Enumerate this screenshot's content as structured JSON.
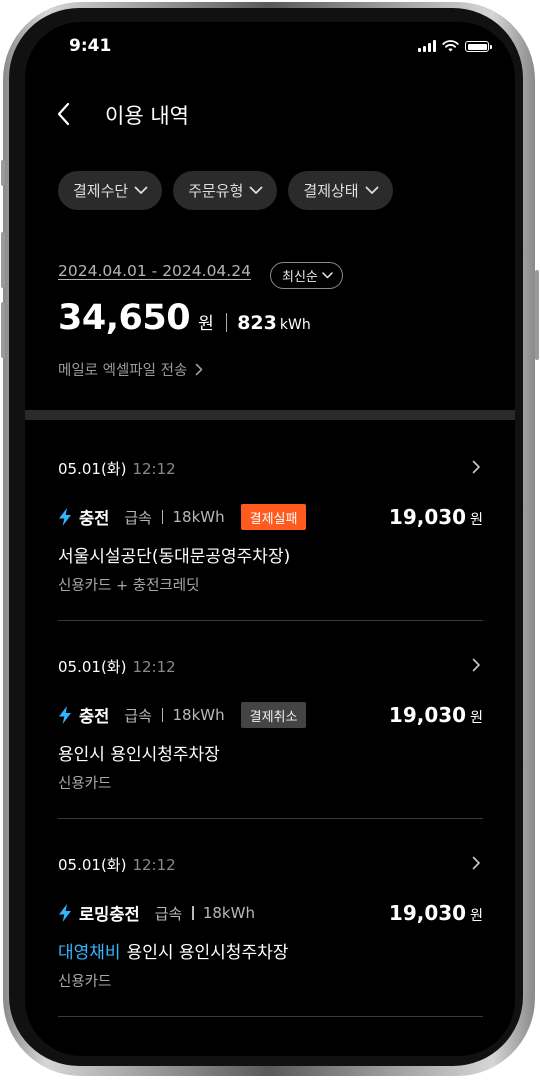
{
  "status_bar": {
    "time": "9:41"
  },
  "header": {
    "title": "이용 내역"
  },
  "filters": [
    {
      "label": "결제수단"
    },
    {
      "label": "주문유형"
    },
    {
      "label": "결제상태"
    }
  ],
  "summary": {
    "date_range": "2024.04.01 - 2024.04.24",
    "sort_label": "최신순",
    "total_amount": "34,650",
    "total_unit": "원",
    "total_kwh": "823",
    "kwh_unit": "kWh",
    "excel_link": "메일로 엑셀파일 전송"
  },
  "items": [
    {
      "date": "05.01(화)",
      "time": "12:12",
      "type": "충전",
      "speed": "급속",
      "energy": "18kWh",
      "status": "결제실패",
      "price": "19,030",
      "price_unit": "원",
      "station": "서울시설공단(동대문공영주차장)",
      "payment": "신용카드 + 충전크레딧"
    },
    {
      "date": "05.01(화)",
      "time": "12:12",
      "type": "충전",
      "speed": "급속",
      "energy": "18kWh",
      "status": "결제취소",
      "price": "19,030",
      "price_unit": "원",
      "station": "용인시 용인시청주차장",
      "payment": "신용카드"
    },
    {
      "date": "05.01(화)",
      "time": "12:12",
      "type": "로밍충전",
      "speed": "급속",
      "energy": "18kWh",
      "partner": "대영채비",
      "price": "19,030",
      "price_unit": "원",
      "station": "용인시 용인시청주차장",
      "payment": "신용카드"
    }
  ],
  "colors": {
    "background": "#000000",
    "fail_badge": "#ff5a1f",
    "cancel_badge": "#444444",
    "partner_text": "#33b4ff",
    "bolt": "#33b4ff"
  }
}
